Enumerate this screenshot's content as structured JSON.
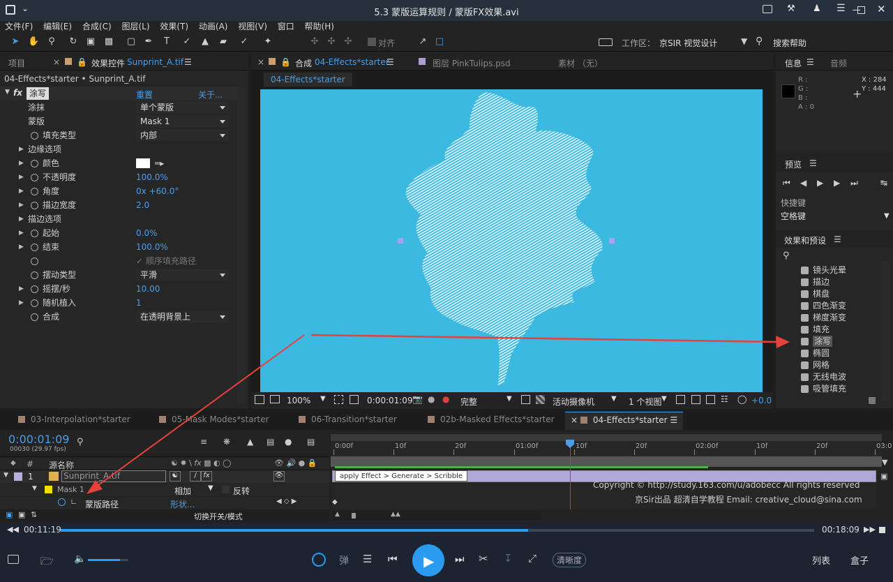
{
  "window": {
    "title": "5.3 蒙版运算规则 / 蒙版FX效果.avi"
  },
  "menu": [
    "文件(F)",
    "编辑(E)",
    "合成(C)",
    "图层(L)",
    "效果(T)",
    "动画(A)",
    "视图(V)",
    "窗口",
    "帮助(H)"
  ],
  "toolbar": {
    "align": "对齐",
    "workspace_label": "工作区：",
    "workspace_value": "京SIR 视觉设计",
    "search_help": "搜索帮助"
  },
  "left": {
    "tab_project": "项目",
    "tab_effects": "效果控件",
    "tab_effects_file": "Sunprint_A.tif",
    "breadcrumb": "04-Effects*starter • Sunprint_A.tif",
    "effect_name": "涂写",
    "reset": "重置",
    "about": "关于...",
    "props": [
      {
        "label": "涂抹",
        "value": "单个蒙版",
        "kind": "dropdown"
      },
      {
        "label": "蒙版",
        "value": "Mask 1",
        "kind": "dropdown"
      },
      {
        "label": "填充类型",
        "value": "内部",
        "kind": "dropdown"
      },
      {
        "label": "边缘选项",
        "value": "",
        "kind": "group"
      },
      {
        "label": "颜色",
        "value": "",
        "kind": "color"
      },
      {
        "label": "不透明度",
        "value": "100.0%",
        "kind": "value"
      },
      {
        "label": "角度",
        "value": "0x +60.0°",
        "kind": "value"
      },
      {
        "label": "描边宽度",
        "value": "2.0",
        "kind": "value"
      },
      {
        "label": "描边选项",
        "value": "",
        "kind": "group"
      },
      {
        "label": "起始",
        "value": "0.0%",
        "kind": "value"
      },
      {
        "label": "结束",
        "value": "100.0%",
        "kind": "value"
      },
      {
        "label": "",
        "value": "顺序填充路径",
        "kind": "checkbox"
      },
      {
        "label": "摆动类型",
        "value": "平滑",
        "kind": "dropdown"
      },
      {
        "label": "摇摆/秒",
        "value": "10.00",
        "kind": "value"
      },
      {
        "label": "随机植入",
        "value": "1",
        "kind": "value"
      },
      {
        "label": "合成",
        "value": "在透明背景上",
        "kind": "dropdown"
      }
    ]
  },
  "comp": {
    "tab_comp_label": "合成",
    "tab_comp_name": "04-Effects*starter",
    "tab_layer": "图层 PinkTulips.psd",
    "tab_footage": "素材 （无）",
    "subtab": "04-Effects*starter",
    "footer": {
      "zoom": "100%",
      "time": "0:00:01:09",
      "quality": "完整",
      "camera": "活动摄像机",
      "views": "1 个视图",
      "exposure": "+0.0"
    }
  },
  "right": {
    "info_tab": "信息",
    "audio_tab": "音频",
    "info": {
      "r": "R :",
      "g": "G :",
      "b": "B :",
      "a": "A : 0",
      "x": "X : 284",
      "y": "Y : 444"
    },
    "preview_tab": "预览",
    "shortcut_label": "快捷键",
    "shortcut_value": "空格键",
    "effects_tab": "效果和预设",
    "effects": [
      "镜头光晕",
      "描边",
      "棋盘",
      "四色渐变",
      "梯度渐变",
      "填充",
      "涂写",
      "椭圆",
      "网格",
      "无线电波",
      "吸管填充"
    ],
    "selected_effect": "涂写"
  },
  "timeline": {
    "tabs": [
      "03-Interpolation*starter",
      "05-Mask Modes*starter",
      "06-Transition*starter",
      "02b-Masked Effects*starter",
      "04-Effects*starter"
    ],
    "tab_colors": [
      "#a08070",
      "#a08070",
      "#a08070",
      "#a08070",
      "#a08070"
    ],
    "timecode": "0:00:01:09",
    "fps": "00030 (29.97 fps)",
    "col_source": "源名称",
    "ruler": [
      "0:00f",
      "10f",
      "20f",
      "01:00f",
      "10f",
      "20f",
      "02:00f",
      "10f",
      "20f",
      "03:0"
    ],
    "layer_num": "1",
    "layer_name": "Sunprint_A.tif",
    "mask_name": "Mask 1",
    "mask_mode": "相加",
    "mask_invert": "反转",
    "mask_path": "蒙版路径",
    "mask_shape": "形状...",
    "bar_label": "apply Effect > Generate > Scribble",
    "switches_label": "切换开关/模式",
    "copyright1": "Copyright © http://study.163.com/u/adobecc All rights reserved",
    "copyright2": "京Sir出品  超清自学教程 Email: creative_cloud@sina.com"
  },
  "player": {
    "current": "00:11:19",
    "total": "00:18:09",
    "progress": 0.62,
    "volume": 0.8,
    "barrage": "弹",
    "quality": "清晰度",
    "list": "列表",
    "box": "盒子",
    "accent": "#2a9bf0"
  }
}
